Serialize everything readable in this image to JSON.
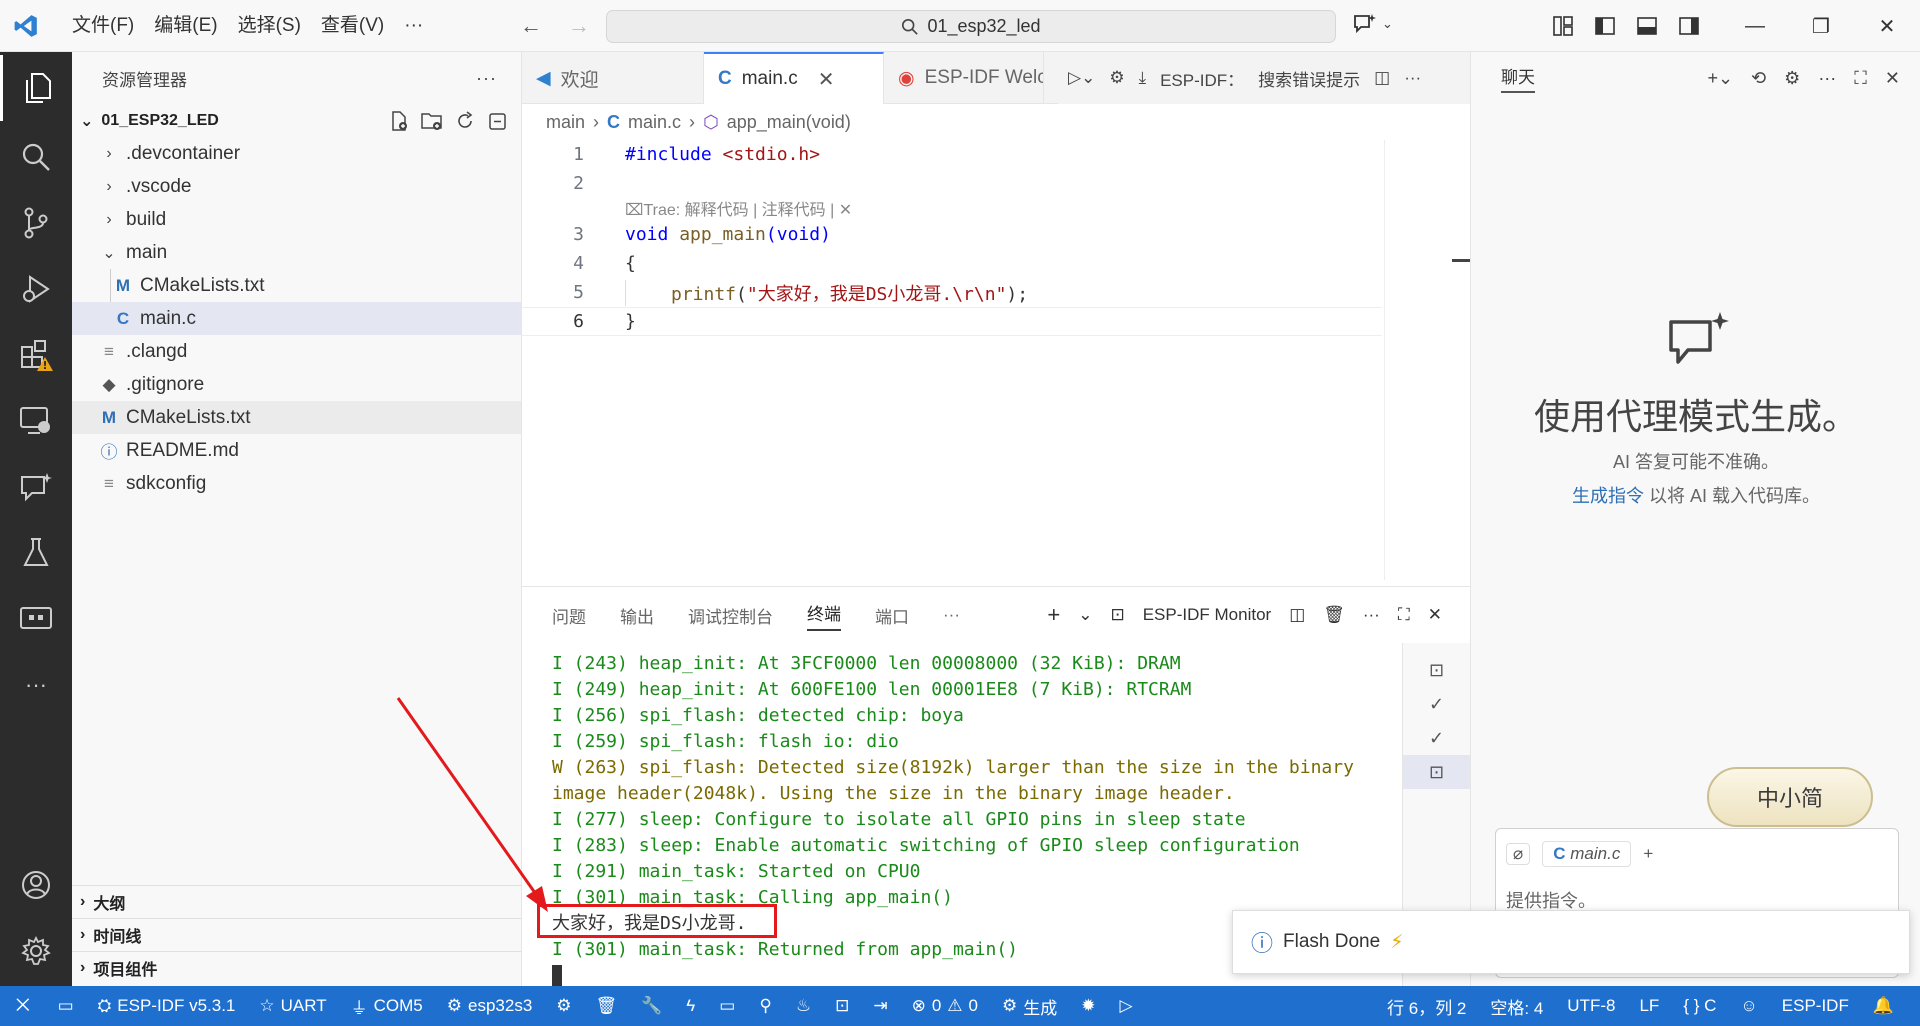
{
  "titlebar": {
    "menu": [
      "文件(F)",
      "编辑(E)",
      "选择(S)",
      "查看(V)",
      "···"
    ],
    "search_text": "01_esp32_led"
  },
  "sidebar": {
    "title": "资源管理器",
    "more": "···",
    "project": "01_ESP32_LED",
    "items": [
      {
        "label": ".devcontainer",
        "type": "folder",
        "expanded": false
      },
      {
        "label": ".vscode",
        "type": "folder",
        "expanded": false
      },
      {
        "label": "build",
        "type": "folder",
        "expanded": false
      },
      {
        "label": "main",
        "type": "folder",
        "expanded": true
      },
      {
        "label": "CMakeLists.txt",
        "type": "cmake"
      },
      {
        "label": "main.c",
        "type": "c"
      },
      {
        "label": ".clangd",
        "type": "text"
      },
      {
        "label": ".gitignore",
        "type": "git"
      },
      {
        "label": "CMakeLists.txt",
        "type": "cmake"
      },
      {
        "label": "README.md",
        "type": "info"
      },
      {
        "label": "sdkconfig",
        "type": "text"
      }
    ],
    "bottom_sections": [
      "大纲",
      "时间线",
      "项目组件"
    ]
  },
  "editor": {
    "tabs": [
      {
        "label": "欢迎",
        "icon": "vscode-icon"
      },
      {
        "label": "main.c",
        "icon": "c-file-icon",
        "active": true
      },
      {
        "label": "ESP-IDF Welc",
        "icon": "esp-idf-icon"
      }
    ],
    "actions_label": "ESP-IDF：",
    "actions_search": "搜索错误提示",
    "breadcrumb": [
      "main",
      "main.c",
      "app_main(void)"
    ],
    "line_numbers": [
      "1",
      "2",
      "3",
      "4",
      "5",
      "6"
    ],
    "code": {
      "l1_kw": "#include",
      "l1_inc": "<stdio.h>",
      "codelens": "Trae: 解释代码 | 注释代码 |",
      "l3_kw": "void",
      "l3_fn": "app_main",
      "l3_args": "(void)",
      "l4": "{",
      "l5_fn": "printf",
      "l5_str": "\"大家好，我是DS小龙哥.\\r\\n\"",
      "l5_end": ");",
      "l6": "}"
    }
  },
  "panel": {
    "tabs": [
      "问题",
      "输出",
      "调试控制台",
      "终端",
      "端口",
      "···"
    ],
    "active_tab": "终端",
    "monitor_label": "ESP-IDF Monitor",
    "terminal_lines": [
      {
        "text": "I (243) heap_init: At 3FCF0000 len 00008000 (32 KiB): DRAM",
        "level": "info"
      },
      {
        "text": "I (249) heap_init: At 600FE100 len 00001EE8 (7 KiB): RTCRAM",
        "level": "info"
      },
      {
        "text": "I (256) spi_flash: detected chip: boya",
        "level": "info"
      },
      {
        "text": "I (259) spi_flash: flash io: dio",
        "level": "info"
      },
      {
        "text": "W (263) spi_flash: Detected size(8192k) larger than the size in the binary",
        "level": "warn"
      },
      {
        "text": "image header(2048k). Using the size in the binary image header.",
        "level": "warn"
      },
      {
        "text": "I (277) sleep: Configure to isolate all GPIO pins in sleep state",
        "level": "info"
      },
      {
        "text": "I (283) sleep: Enable automatic switching of GPIO sleep configuration",
        "level": "info"
      },
      {
        "text": "I (291) main_task: Started on CPU0",
        "level": "info"
      },
      {
        "text": "I (301) main_task: Calling app_main()",
        "level": "info"
      },
      {
        "text": "大家好，我是DS小龙哥.",
        "level": "plain"
      },
      {
        "text": "I (301) main_task: Returned from app_main()",
        "level": "info"
      }
    ]
  },
  "chat": {
    "title": "聊天",
    "heading": "使用代理模式生成。",
    "sub1": "AI 答复可能不准确。",
    "sub2_link": "生成指令",
    "sub2_rest": " 以将 AI 载入代码库。",
    "sticker_text": "中小简",
    "context_file": "main.c",
    "placeholder": "提供指令。"
  },
  "notification": {
    "text": "Flash Done"
  },
  "statusbar": {
    "left": [
      "ESP-IDF v5.3.1",
      "UART",
      "COM5",
      "esp32s3"
    ],
    "errors": "0",
    "warnings": "0",
    "build": "生成",
    "right": [
      "行 6，列 2",
      "空格: 4",
      "UTF-8",
      "LF",
      "{ } C",
      "ESP-IDF"
    ]
  },
  "colors": {
    "statusbar": "#1f6fce",
    "activitybar": "#2c2c2c",
    "terminal_info": "#1a8a1a",
    "terminal_warn": "#7a6a00",
    "annotation": "#e3191c"
  }
}
